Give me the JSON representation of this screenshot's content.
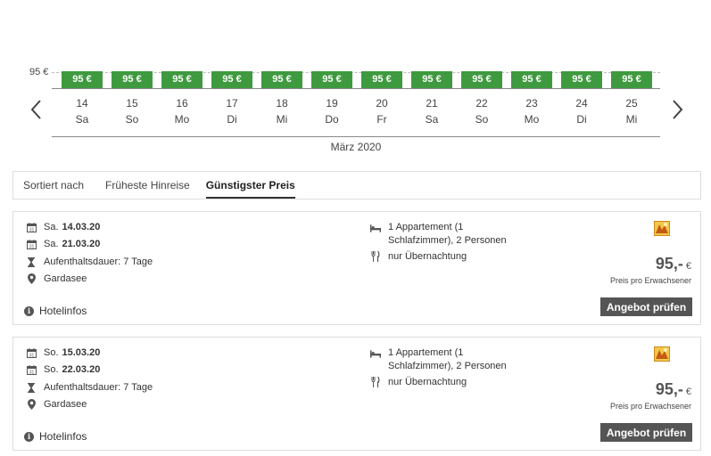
{
  "calendar": {
    "y_label": "95 €",
    "month": "März 2020",
    "days": [
      {
        "num": "14",
        "name": "Sa",
        "price": "95 €"
      },
      {
        "num": "15",
        "name": "So",
        "price": "95 €"
      },
      {
        "num": "16",
        "name": "Mo",
        "price": "95 €"
      },
      {
        "num": "17",
        "name": "Di",
        "price": "95 €"
      },
      {
        "num": "18",
        "name": "Mi",
        "price": "95 €"
      },
      {
        "num": "19",
        "name": "Do",
        "price": "95 €"
      },
      {
        "num": "20",
        "name": "Fr",
        "price": "95 €"
      },
      {
        "num": "21",
        "name": "Sa",
        "price": "95 €"
      },
      {
        "num": "22",
        "name": "So",
        "price": "95 €"
      },
      {
        "num": "23",
        "name": "Mo",
        "price": "95 €"
      },
      {
        "num": "24",
        "name": "Di",
        "price": "95 €"
      },
      {
        "num": "25",
        "name": "Mi",
        "price": "95 €"
      }
    ]
  },
  "sort": {
    "label": "Sortiert nach",
    "options": [
      "Früheste Hinreise",
      "Günstigster Preis"
    ],
    "active": "Günstigster Preis"
  },
  "offers": [
    {
      "from_day": "Sa.",
      "from_date": "14.03.20",
      "to_day": "Sa.",
      "to_date": "21.03.20",
      "duration": "Aufenthaltsdauer: 7 Tage",
      "location": "Gardasee",
      "room": "1 Appartement (1 Schlafzimmer), 2 Personen",
      "board": "nur Übernachtung",
      "hotelinfo": "Hotelinfos",
      "price": "95,-",
      "currency": "€",
      "price_note": "Preis pro Erwachsener",
      "button": "Angebot prüfen"
    },
    {
      "from_day": "So.",
      "from_date": "15.03.20",
      "to_day": "So.",
      "to_date": "22.03.20",
      "duration": "Aufenthaltsdauer: 7 Tage",
      "location": "Gardasee",
      "room": "1 Appartement (1 Schlafzimmer), 2 Personen",
      "board": "nur Übernachtung",
      "hotelinfo": "Hotelinfos",
      "price": "95,-",
      "currency": "€",
      "price_note": "Preis pro Erwachsener",
      "button": "Angebot prüfen"
    }
  ],
  "icons": {
    "calendar": "calendar-icon",
    "hourglass": "hourglass-icon",
    "pin": "location-pin-icon",
    "bed": "bed-icon",
    "cutlery": "cutlery-icon",
    "info": "info-icon",
    "badge": "hotel-badge-icon"
  },
  "colors": {
    "price_bar": "#3f9a3f",
    "button": "#555555"
  }
}
